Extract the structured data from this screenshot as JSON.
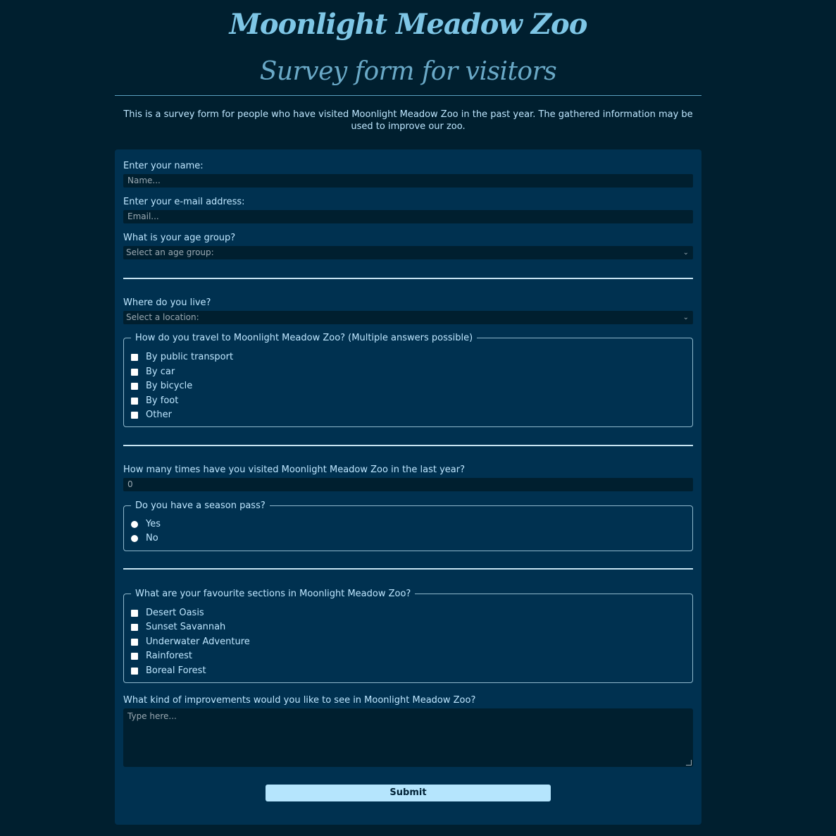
{
  "header": {
    "title": "Moonlight Meadow Zoo",
    "subtitle": "Survey form for visitors",
    "intro": "This is a survey form for people who have visited Moonlight Meadow Zoo in the past year. The gathered information may be used to improve our zoo."
  },
  "form": {
    "name_label": "Enter your name:",
    "name_placeholder": "Name...",
    "email_label": "Enter your e-mail address:",
    "email_placeholder": "Email...",
    "age_label": "What is your age group?",
    "age_selected": "Select an age group:",
    "location_label": "Where do you live?",
    "location_selected": "Select a location:",
    "travel_legend": "How do you travel to Moonlight Meadow Zoo? (Multiple answers possible)",
    "travel_options": [
      "By public transport",
      "By car",
      "By bicycle",
      "By foot",
      "Other"
    ],
    "visits_label": "How many times have you visited Moonlight Meadow Zoo in the last year?",
    "visits_value": "0",
    "pass_legend": "Do you have a season pass?",
    "pass_options": [
      "Yes",
      "No"
    ],
    "sections_legend": "What are your favourite sections in Moonlight Meadow Zoo?",
    "sections_options": [
      "Desert Oasis",
      "Sunset Savannah",
      "Underwater Adventure",
      "Rainforest",
      "Boreal Forest"
    ],
    "improve_label": "What kind of improvements would you like to see in Moonlight Meadow Zoo?",
    "improve_placeholder": "Type here...",
    "submit_label": "Submit"
  },
  "icons": {
    "select_arrow": "chevron-down-icon"
  },
  "colors": {
    "background": "#001f2f",
    "form_background": "#003150",
    "text": "#bfe7ff",
    "title": "#7ec6e6",
    "button": "#b5e5fd"
  }
}
